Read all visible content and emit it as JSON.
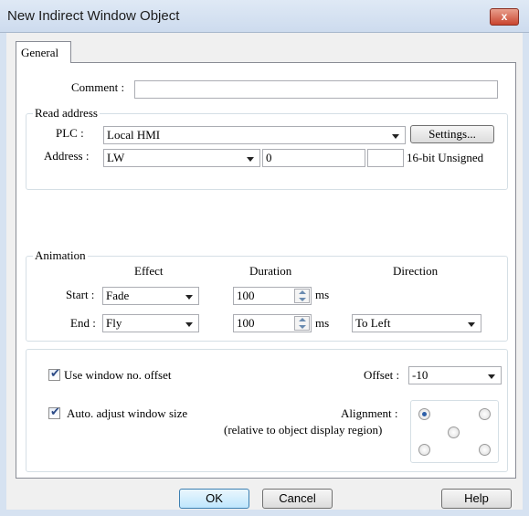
{
  "window": {
    "title": "New Indirect Window Object",
    "close_label": "x"
  },
  "tabs": {
    "general": "General"
  },
  "comment": {
    "label": "Comment :",
    "value": ""
  },
  "read_address": {
    "legend": "Read address",
    "plc_label": "PLC :",
    "plc_value": "Local HMI",
    "settings_label": "Settings...",
    "address_label": "Address :",
    "address_device": "LW",
    "address_value": "0",
    "address_extra": "",
    "data_type": "16-bit Unsigned"
  },
  "animation": {
    "legend": "Animation",
    "col_effect": "Effect",
    "col_duration": "Duration",
    "col_direction": "Direction",
    "start_label": "Start :",
    "start_effect": "Fade",
    "start_duration": "100",
    "start_unit": "ms",
    "end_label": "End :",
    "end_effect": "Fly",
    "end_duration": "100",
    "end_unit": "ms",
    "end_direction": "To Left"
  },
  "options": {
    "use_offset_label": "Use window no. offset",
    "use_offset_checked": true,
    "offset_label": "Offset :",
    "offset_value": "-10",
    "auto_adjust_label": "Auto. adjust window size",
    "auto_adjust_checked": true,
    "alignment_label": "Alignment :",
    "alignment_note": "(relative to object display region)",
    "alignment_selected": "top-left"
  },
  "footer": {
    "ok_label": "OK",
    "cancel_label": "Cancel",
    "help_label": "Help"
  }
}
